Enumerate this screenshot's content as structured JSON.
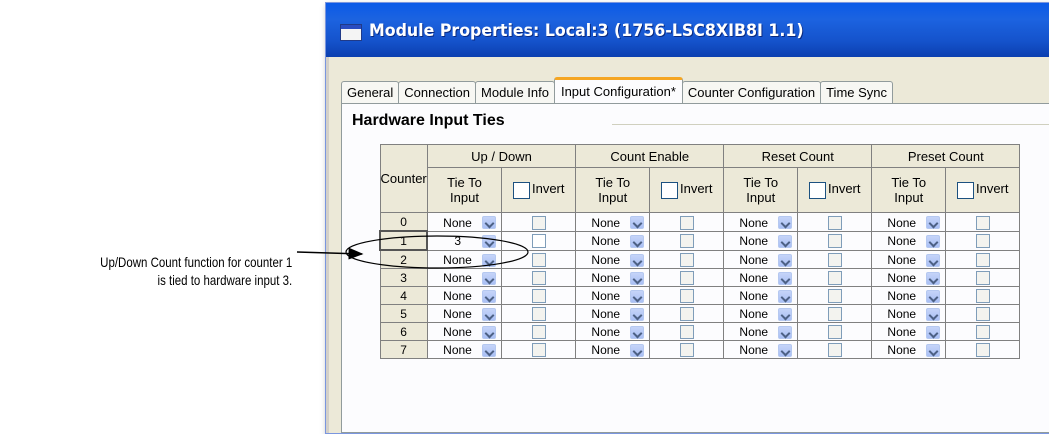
{
  "annotation": {
    "line1": "Up/Down Count function for counter 1",
    "line2": "is tied to hardware input 3."
  },
  "window": {
    "title": "Module Properties: Local:3 (1756-LSC8XIB8I 1.1)"
  },
  "tabs": [
    {
      "label": "General",
      "active": false
    },
    {
      "label": "Connection",
      "active": false
    },
    {
      "label": "Module Info",
      "active": false
    },
    {
      "label": "Input Configuration*",
      "active": true
    },
    {
      "label": "Counter Configuration",
      "active": false
    },
    {
      "label": "Time Sync",
      "active": false
    }
  ],
  "section": {
    "title": "Hardware Input Ties"
  },
  "table": {
    "counter_header": "Counter",
    "groups": [
      "Up / Down",
      "Count Enable",
      "Reset Count",
      "Preset Count"
    ],
    "tie_header_1": "Tie To",
    "tie_header_2": "Input",
    "invert_header": "Invert",
    "rows": [
      {
        "counter": "0",
        "ties": [
          "None",
          "None",
          "None",
          "None"
        ]
      },
      {
        "counter": "1",
        "ties": [
          "3",
          "None",
          "None",
          "None"
        ]
      },
      {
        "counter": "2",
        "ties": [
          "None",
          "None",
          "None",
          "None"
        ]
      },
      {
        "counter": "3",
        "ties": [
          "None",
          "None",
          "None",
          "None"
        ]
      },
      {
        "counter": "4",
        "ties": [
          "None",
          "None",
          "None",
          "None"
        ]
      },
      {
        "counter": "5",
        "ties": [
          "None",
          "None",
          "None",
          "None"
        ]
      },
      {
        "counter": "6",
        "ties": [
          "None",
          "None",
          "None",
          "None"
        ]
      },
      {
        "counter": "7",
        "ties": [
          "None",
          "None",
          "None",
          "None"
        ]
      }
    ]
  },
  "colors": {
    "titlebar": "#1553cc",
    "tab_accent": "#f5a623",
    "dialog_bg": "#ece9d8"
  }
}
